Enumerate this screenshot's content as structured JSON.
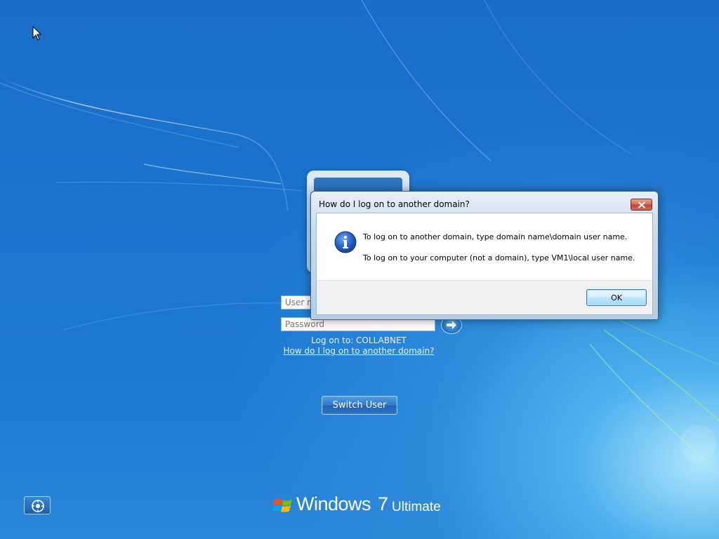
{
  "logon_screen": {
    "username_placeholder": "User name",
    "password_placeholder": "Password",
    "logon_to_label": "Log on to: COLLABNET",
    "domain_help_link": "How do I log on to another domain?",
    "switch_user_label": "Switch User"
  },
  "branding": {
    "product": "Windows",
    "version": "7",
    "edition": "Ultimate"
  },
  "dialog": {
    "title": "How do I log on to another domain?",
    "message_line_1": "To log on to another domain, type domain name\\domain user name.",
    "message_line_2": "To log on to your computer (not a domain), type VM1\\local user name.",
    "ok_label": "OK",
    "icon": "info-icon"
  },
  "colors": {
    "background_blue": "#1c74cf",
    "dialog_frame": "#b6cde4",
    "close_button_red": "#c3432f",
    "info_icon_blue": "#1a4fa8"
  }
}
